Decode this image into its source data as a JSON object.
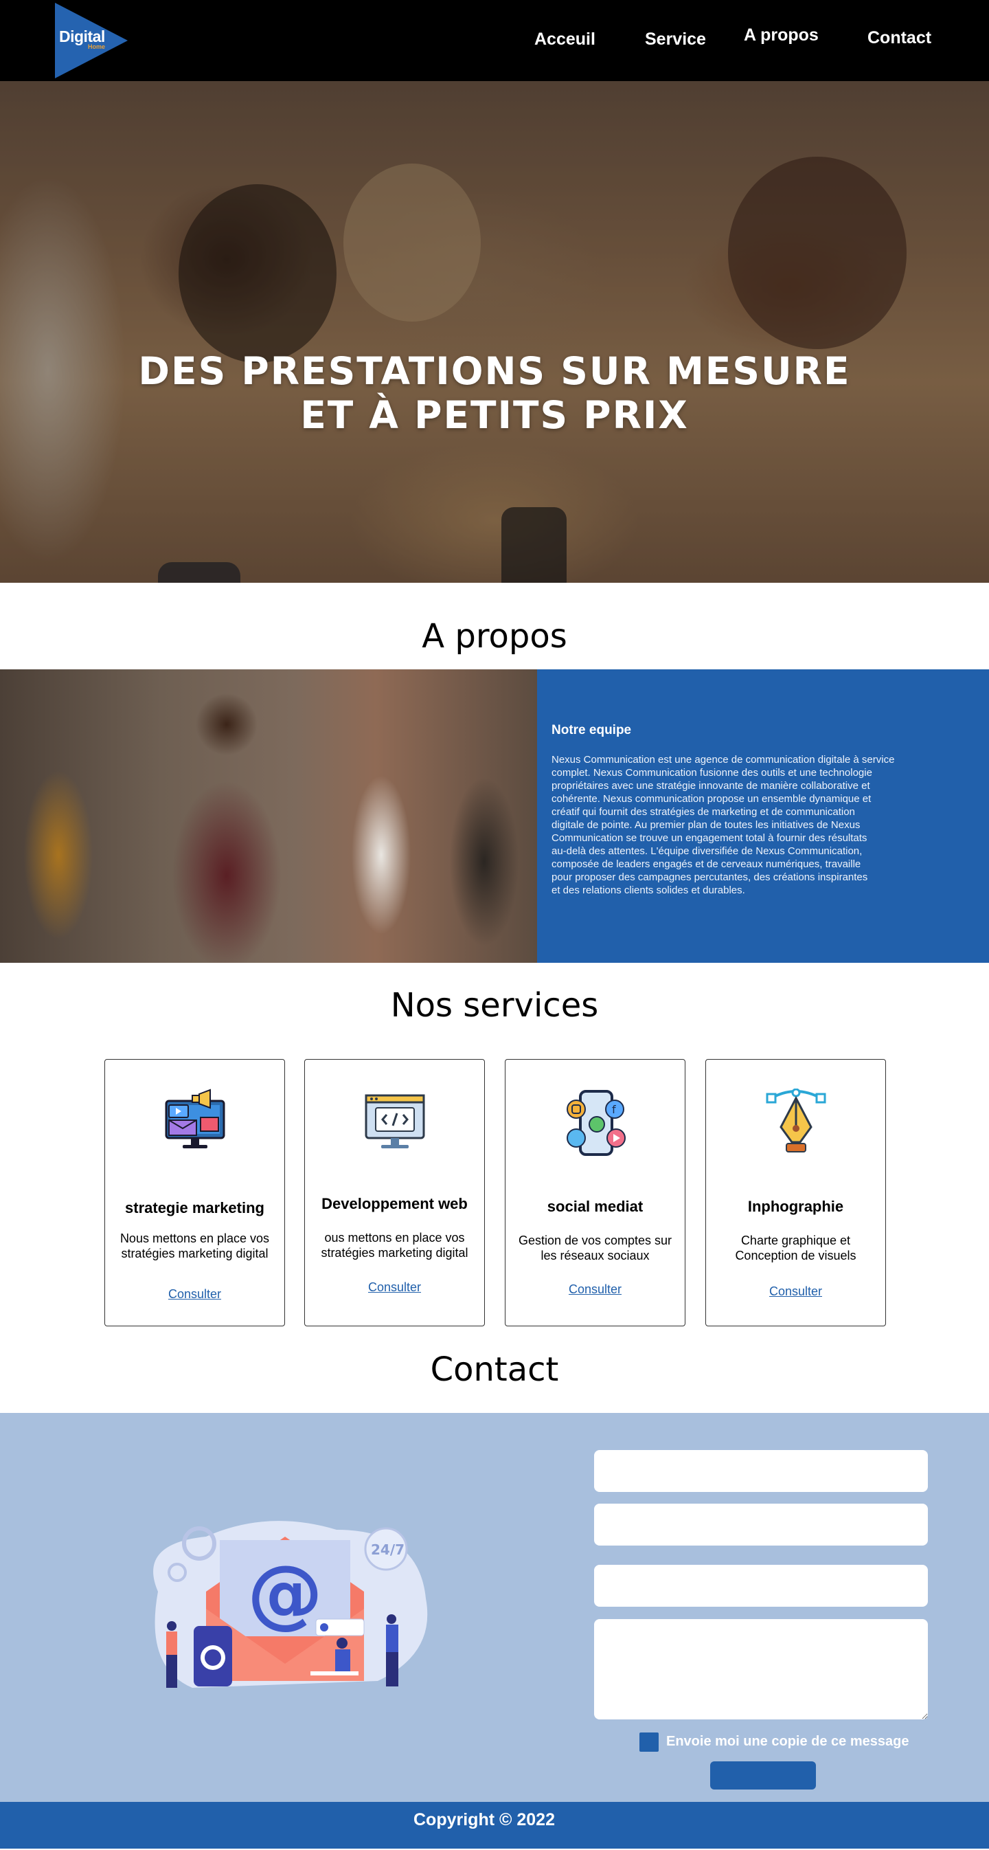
{
  "brand": {
    "logo_word": "Digital",
    "logo_sub": "Home",
    "accent": "#2160ab",
    "logo_accent": "#e8a23a"
  },
  "nav": {
    "items": [
      {
        "label": "Acceuil"
      },
      {
        "label": "Service"
      },
      {
        "label": "A propos"
      },
      {
        "label": "Contact"
      }
    ]
  },
  "hero": {
    "line1": "DES PRESTATIONS SUR MESURE",
    "line2": "ET À PETITS PRIX"
  },
  "about": {
    "title": "A propos",
    "heading": "Notre equipe",
    "text_lines": [
      "Nexus Communication est une agence de communication digitale à service",
      " complet. Nexus Communication fusionne des outils et une technologie",
      "propriétaires avec une stratégie innovante de manière collaborative et",
      " cohérente. Nexus communication propose un ensemble dynamique et",
      "créatif qui fournit des stratégies de marketing et de communication",
      "digitale de pointe. Au premier plan de toutes les initiatives de Nexus",
      "Communication se trouve un engagement total à fournir des résultats",
      " au-delà des attentes. L'équipe diversifiée de Nexus Communication,",
      "composée de leaders engagés et de cerveaux numériques, travaille",
      "pour proposer des campagnes percutantes, des créations inspirantes",
      "et des relations clients solides et durables."
    ]
  },
  "services": {
    "title": "Nos services",
    "cards": [
      {
        "icon": "marketing-monitor-icon",
        "title": "strategie marketing",
        "desc_lines": [
          "Nous mettons en place vos",
          "stratégies marketing digital"
        ],
        "link": "Consulter"
      },
      {
        "icon": "code-monitor-icon",
        "title": "Developpement web",
        "desc_lines": [
          "ous mettons en place vos",
          "stratégies marketing digital"
        ],
        "link": "Consulter"
      },
      {
        "icon": "social-phone-icon",
        "title": "social mediat",
        "desc_lines": [
          "Gestion de vos comptes sur",
          "les réseaux sociaux"
        ],
        "link": "Consulter"
      },
      {
        "icon": "pen-tool-icon",
        "title": "Inphographie",
        "desc_lines": [
          "Charte graphique et",
          "Conception de visuels"
        ],
        "link": "Consulter"
      }
    ]
  },
  "contact": {
    "title": "Contact",
    "illustration_badge": "24/7",
    "illustration_symbol": "@",
    "fields": [
      {
        "value": "",
        "placeholder": ""
      },
      {
        "value": "",
        "placeholder": ""
      },
      {
        "value": "",
        "placeholder": ""
      },
      {
        "value": "",
        "placeholder": ""
      }
    ],
    "copy_label": "Envoie moi une copie de ce message",
    "submit_label": ""
  },
  "footer": {
    "copyright": "Copyright © 2022"
  }
}
